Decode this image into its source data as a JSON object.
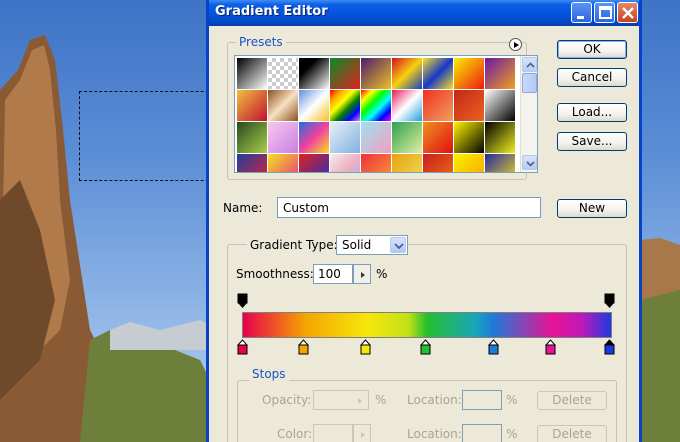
{
  "dialog": {
    "title": "Gradient Editor",
    "presets_label": "Presets",
    "buttons": {
      "ok": "OK",
      "cancel": "Cancel",
      "load": "Load...",
      "save": "Save...",
      "new": "New"
    },
    "name_label": "Name:",
    "name_value": "Custom",
    "gradient_type_label": "Gradient Type:",
    "gradient_type_value": "Solid",
    "smoothness_label": "Smoothness:",
    "smoothness_value": "100",
    "smoothness_unit": "%",
    "stops": {
      "label": "Stops",
      "opacity_label": "Opacity:",
      "opacity_unit": "%",
      "color_label": "Color:",
      "location_label": "Location:",
      "location_unit": "%",
      "delete_label": "Delete"
    },
    "color_stops": [
      "#e8004d",
      "#f4a500",
      "#f6e70a",
      "#24c02e",
      "#1e7ad8",
      "#e81396",
      "#1c3ae0"
    ]
  },
  "colors": {
    "titlebar": "#0553dc",
    "window_bg": "#ece9d8",
    "accent_text": "#1a52c9"
  }
}
